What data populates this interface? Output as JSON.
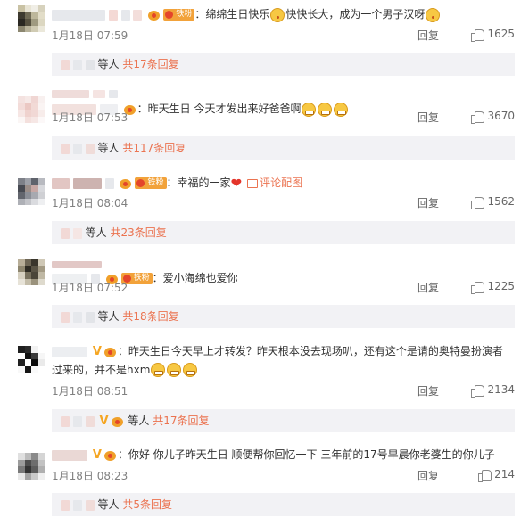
{
  "colors": {
    "link": "#eb7350",
    "meta": "#808080",
    "subbox_bg": "#f2f2f5",
    "fan_badge": "#f2a23a"
  },
  "comments": [
    {
      "text": "：绵绵生日快乐",
      "text2": "快快长大，成为一个男子汉呀",
      "badge": "铁粉",
      "date": "1月18日 07:59",
      "reply": "回复",
      "likes": "1625",
      "sub_who": "等人",
      "sub_count": "共17条回复"
    },
    {
      "text": "：昨天生日 今天才发出来好爸爸啊",
      "date": "1月18日 07:53",
      "reply": "回复",
      "likes": "3670",
      "sub_who": "等人",
      "sub_count": "共117条回复"
    },
    {
      "text": "：幸福的一家",
      "pic_link": "评论配图",
      "badge": "铁粉",
      "date": "1月18日 08:04",
      "reply": "回复",
      "likes": "1562",
      "sub_who": "等人",
      "sub_count": "共23条回复"
    },
    {
      "text": "：爱小海绵也爱你",
      "badge": "铁粉",
      "date": "1月18日 07:52",
      "reply": "回复",
      "likes": "1225",
      "sub_who": "等人",
      "sub_count": "共18条回复"
    },
    {
      "text": "：昨天生日今天早上才转发？昨天根本没去现场叭，还有这个是请的奥特曼扮演者过来的，并不是hxm",
      "date": "1月18日 08:51",
      "reply": "回复",
      "likes": "2134",
      "sub_who": "等人",
      "sub_count": "共17条回复"
    },
    {
      "text": "：你好 你儿子昨天生日 顺便帮你回忆一下 三年前的17号早晨你老婆生的你儿子",
      "date": "1月18日 08:23",
      "reply": "回复",
      "likes": "214",
      "sub_who": "等人",
      "sub_count": "共5条回复"
    }
  ]
}
